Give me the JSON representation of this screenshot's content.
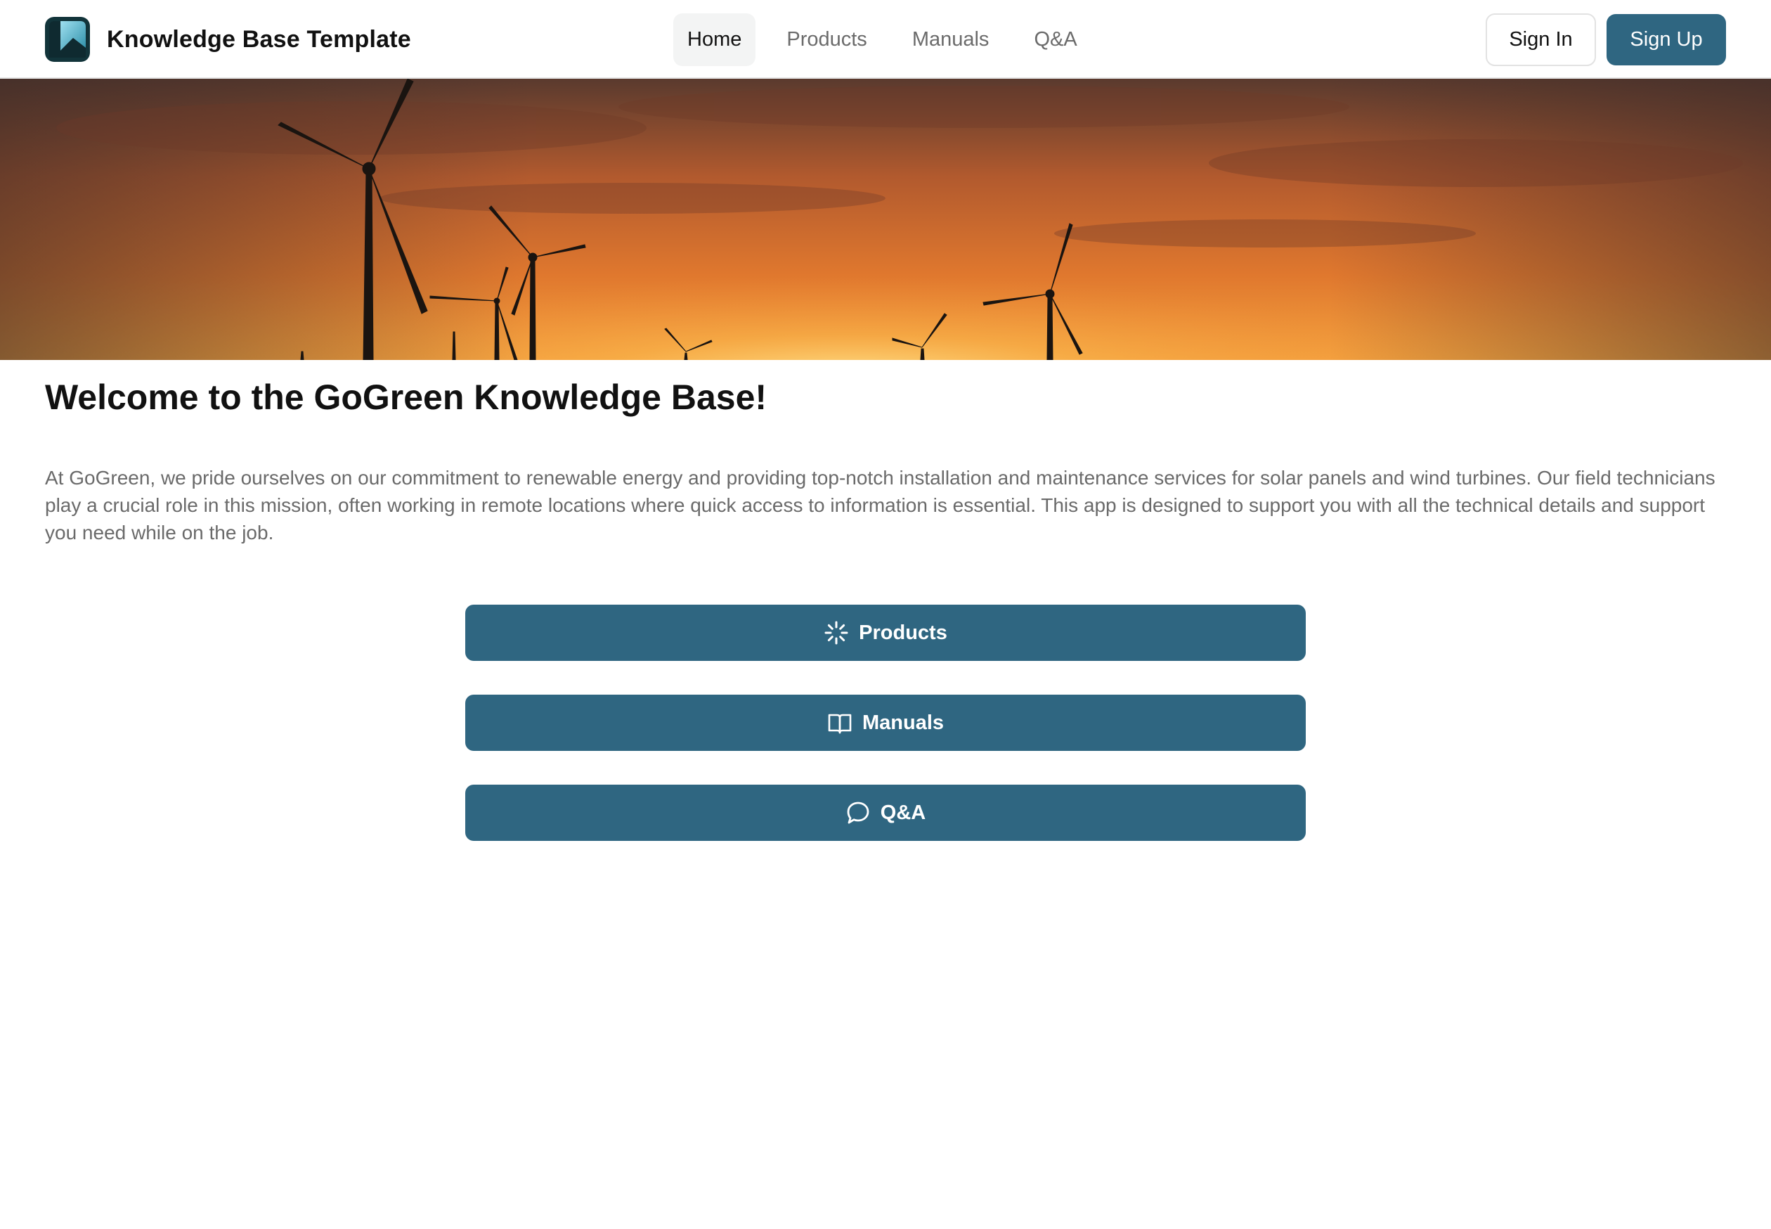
{
  "header": {
    "brand_name": "Knowledge Base Template",
    "logo_icon": "bookmark-logo-icon",
    "nav": [
      {
        "label": "Home",
        "active": true
      },
      {
        "label": "Products",
        "active": false
      },
      {
        "label": "Manuals",
        "active": false
      },
      {
        "label": "Q&A",
        "active": false
      }
    ],
    "sign_in_label": "Sign In",
    "sign_up_label": "Sign Up"
  },
  "hero": {
    "image": "wind-turbines-sunset-banner"
  },
  "main": {
    "title": "Welcome to the GoGreen Knowledge Base!",
    "intro": "At GoGreen, we pride ourselves on our commitment to renewable energy and providing top-notch installation and maintenance services for solar panels and wind turbines. Our field technicians play a crucial role in this mission, often working in remote locations where quick access to information is essential. This app is designed to support you with all the technical details and support you need while on the job.",
    "actions": [
      {
        "label": "Products",
        "icon": "loader-icon"
      },
      {
        "label": "Manuals",
        "icon": "open-book-icon"
      },
      {
        "label": "Q&A",
        "icon": "speech-bubble-icon"
      }
    ]
  },
  "colors": {
    "primary": "#2f6681",
    "nav_active_bg": "#f3f4f4",
    "muted_text": "#6a6a6a",
    "border": "#e2e2e2"
  }
}
